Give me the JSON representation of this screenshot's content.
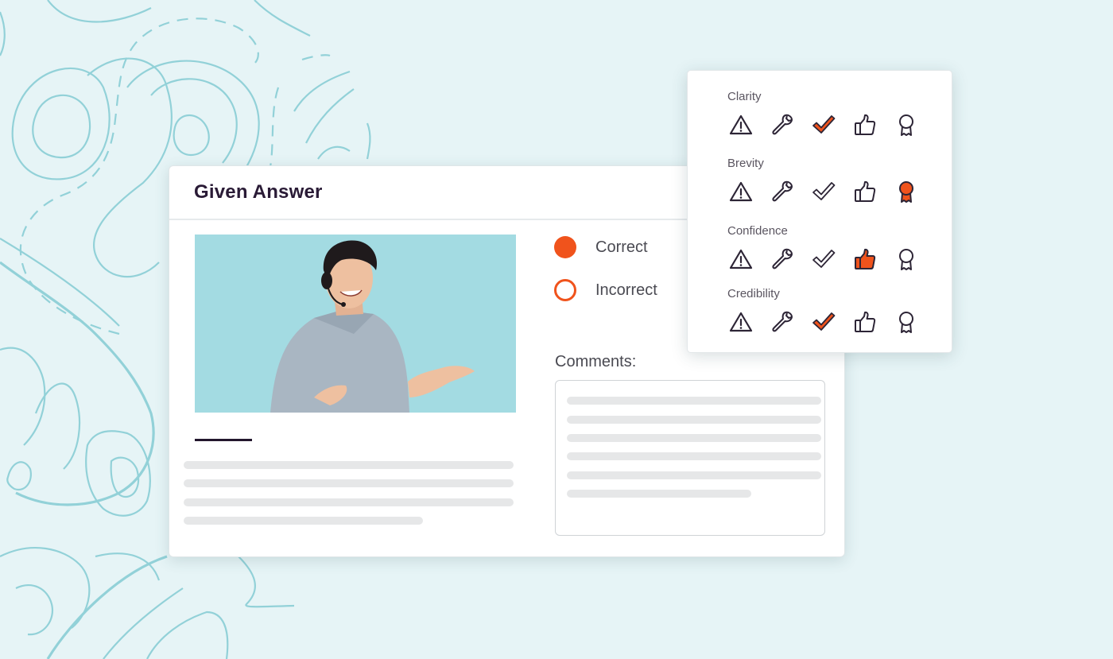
{
  "colors": {
    "accent": "#f0531c",
    "background": "#e6f4f6",
    "contour": "#92d1d8",
    "title_text": "#2a1b36",
    "icon_outline": "#2d2536",
    "skeleton": "#e6e7e8",
    "photo_bg": "#a3dbe2"
  },
  "answer_card": {
    "title": "Given Answer",
    "video_thumbnail": "presenter-with-headset",
    "options": [
      {
        "label": "Correct",
        "selected": true
      },
      {
        "label": "Incorrect",
        "selected": false
      }
    ],
    "comments_label": "Comments:",
    "comments_placeholder_lines": 6,
    "description_placeholder_lines": 4
  },
  "rating_panel": {
    "icon_set": [
      "warning-icon",
      "wrench-icon",
      "checkmark-icon",
      "thumbs-up-icon",
      "award-ribbon-icon"
    ],
    "criteria": [
      {
        "label": "Clarity",
        "selected": "checkmark-icon"
      },
      {
        "label": "Brevity",
        "selected": "award-ribbon-icon"
      },
      {
        "label": "Confidence",
        "selected": "thumbs-up-icon"
      },
      {
        "label": "Credibility",
        "selected": "checkmark-icon"
      }
    ]
  }
}
